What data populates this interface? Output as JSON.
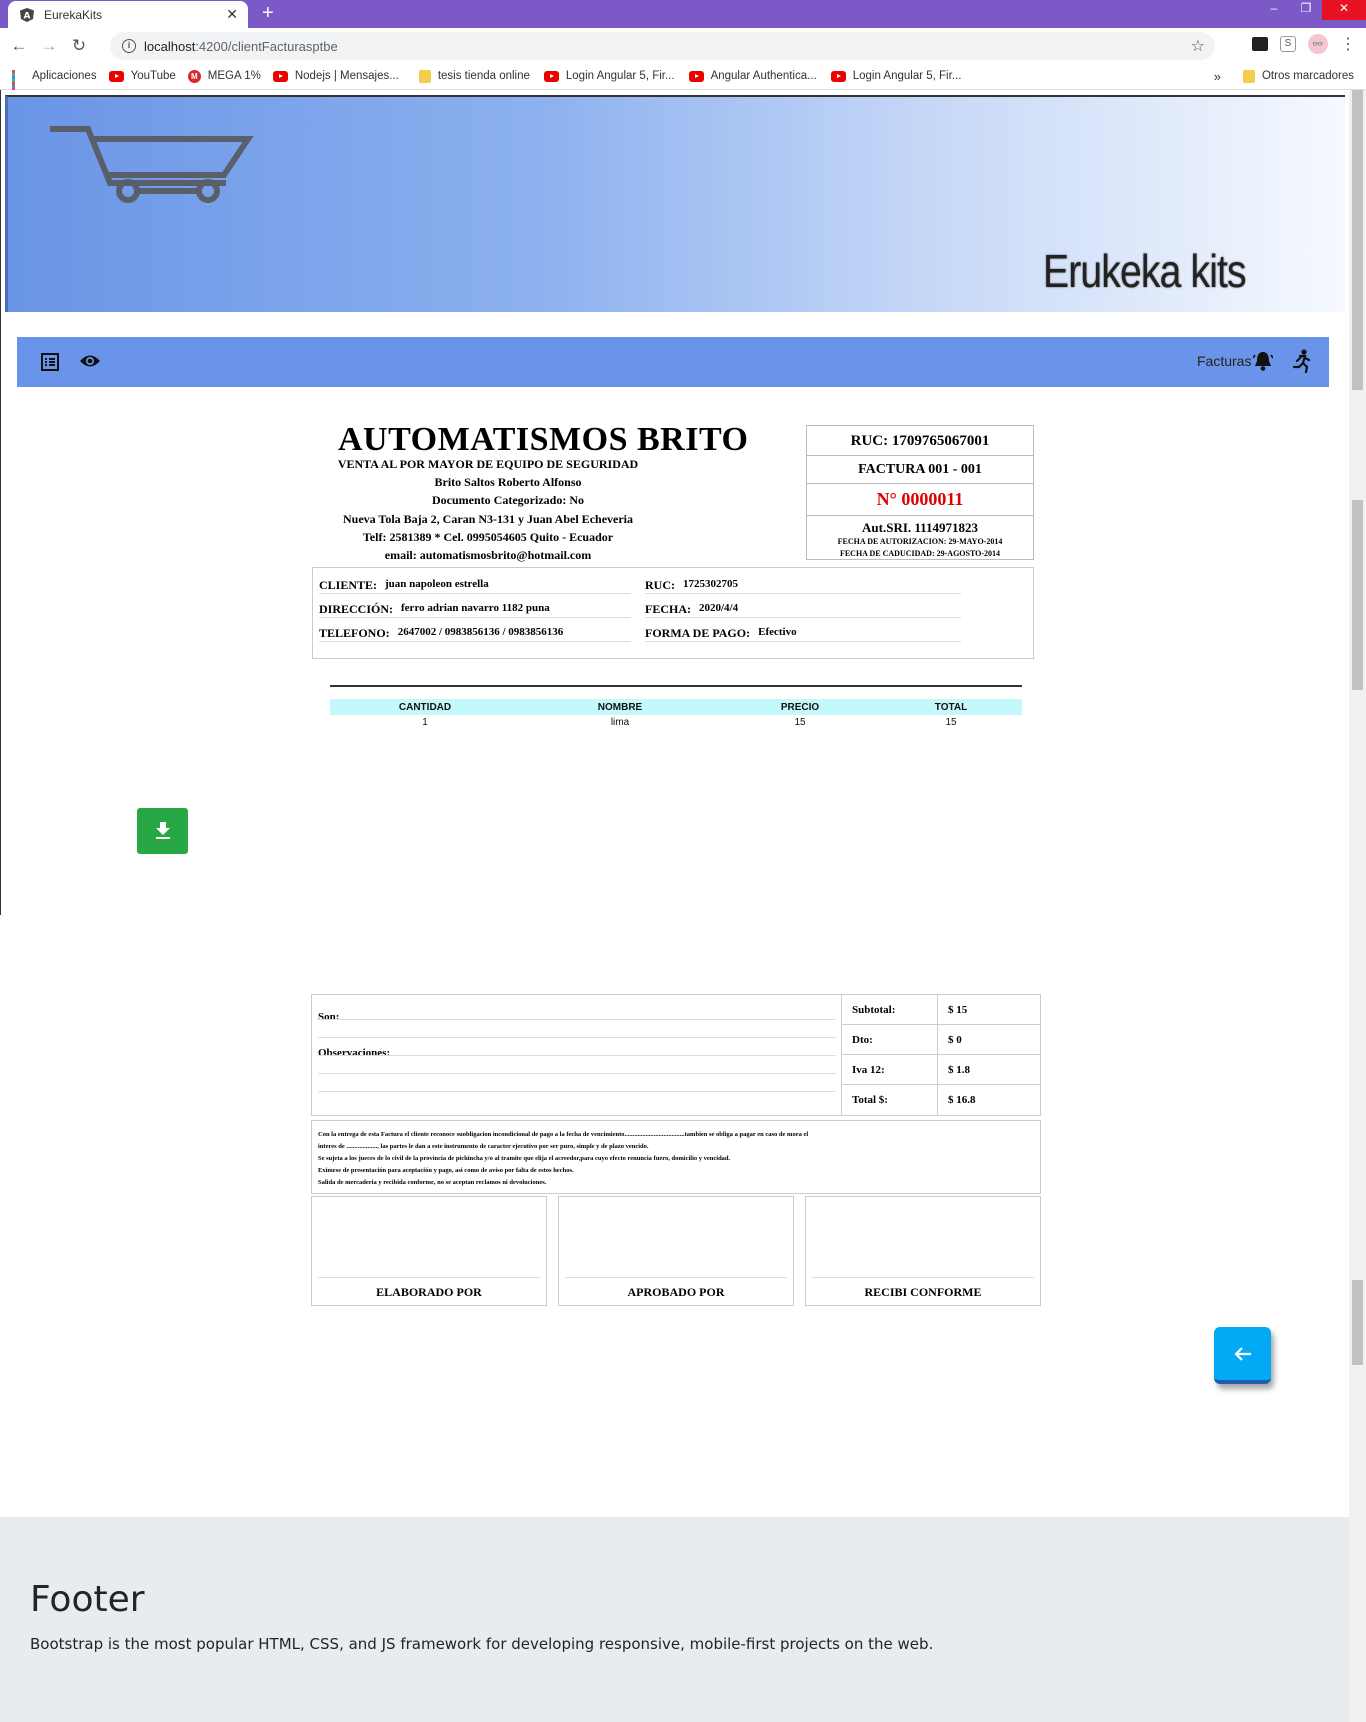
{
  "browser": {
    "tab_title": "EurekaKits",
    "url_host": "localhost",
    "url_path": ":4200/clientFacturasptbe",
    "bookmarks": [
      {
        "label": "Aplicaciones",
        "icon": "apps-icon"
      },
      {
        "label": "YouTube",
        "icon": "youtube-icon"
      },
      {
        "label": "MEGA 1%",
        "icon": "mega-icon"
      },
      {
        "label": "Nodejs | Mensajes...",
        "icon": "youtube-icon"
      },
      {
        "label": "tesis tienda online",
        "icon": "folder-icon"
      },
      {
        "label": "Login Angular 5, Fir...",
        "icon": "youtube-icon"
      },
      {
        "label": "Angular Authentica...",
        "icon": "youtube-icon"
      },
      {
        "label": "Login Angular 5, Fir...",
        "icon": "youtube-icon"
      }
    ],
    "bookmarks_more": "»",
    "other_bookmarks": "Otros marcadores"
  },
  "header": {
    "brand": "Erukeka kits"
  },
  "navbar": {
    "factura_label": "Facturas"
  },
  "invoice": {
    "company": "AUTOMATISMOS BRITO",
    "lines": [
      "VENTA AL POR MAYOR DE EQUIPO DE SEGURIDAD",
      "Brito Saltos Roberto Alfonso",
      "Documento Categorizado: No",
      "Nueva Tola Baja 2, Caran N3-131 y Juan Abel Echeveria",
      "Telf: 2581389 * Cel. 0995054605 Quito - Ecuador",
      "email: automatismosbrito@hotmail.com"
    ],
    "ruc": "RUC: 1709765067001",
    "factura": "FACTURA 001 - 001",
    "numero": "N° 0000011",
    "aut_sri": "Aut.SRI. 1114971823",
    "fecha_autorizacion": "FECHA DE AUTORIZACION: 29-MAYO-2014",
    "fecha_caducidad": "FECHA DE CADUCIDAD: 29-AGOSTO-2014",
    "client": {
      "cliente_label": "CLIENTE:",
      "cliente": "juan napoleon estrella",
      "ruc_label": "RUC:",
      "ruc": "1725302705",
      "direccion_label": "DIRECCIÓN:",
      "direccion": "ferro adrian navarro 1182 puna",
      "fecha_label": "FECHA:",
      "fecha": "2020/4/4",
      "telefono_label": "TELEFONO:",
      "telefono": "2647002 / 0983856136 / 0983856136",
      "pago_label": "FORMA DE PAGO:",
      "pago": "Efectivo"
    },
    "table": {
      "headers": [
        "CANTIDAD",
        "NOMBRE",
        "PRECIO",
        "TOTAL"
      ],
      "rows": [
        [
          "1",
          "lima",
          "15",
          "15"
        ]
      ]
    },
    "son_label": "Son:",
    "obs_label": "Observaciones:",
    "totals": [
      {
        "label": "Subtotal:",
        "value": "$ 15"
      },
      {
        "label": "Dto:",
        "value": "$ 0"
      },
      {
        "label": "Iva 12:",
        "value": "$ 1.8"
      },
      {
        "label": "Total $:",
        "value": "$ 16.8"
      }
    ],
    "terms": [
      "Con la entrega de esta Factura el cliente reconoce suobligacion incondicional de pago a la fecha de vencimiento.....................................tambien se obliga a pagar en caso de mora el",
      " interes de ..................., las partes le dan a este instrumento de caracter ejecutivo por ser puro, simple y de plazo vencido.",
      "Se sujeta a los jueces de lo civil de la provincia de pichincha y/o al tramite que elija el acreedor,para cuyo efecto renuncia fuero, domicilio y vencidad.",
      "Eximese de presentación para aceptación y pago, asi como de aviso por falta de estos hechos.",
      "Salida de mercaderia y recibida conforme, no se aceptan reclamos ni devoluciones."
    ],
    "signatures": [
      "ELABORADO POR",
      "APROBADO POR",
      "RECIBI CONFORME"
    ]
  },
  "footer": {
    "title": "Footer",
    "text": "Bootstrap is the most popular HTML, CSS, and JS framework for developing responsive, mobile-first projects on the web."
  }
}
